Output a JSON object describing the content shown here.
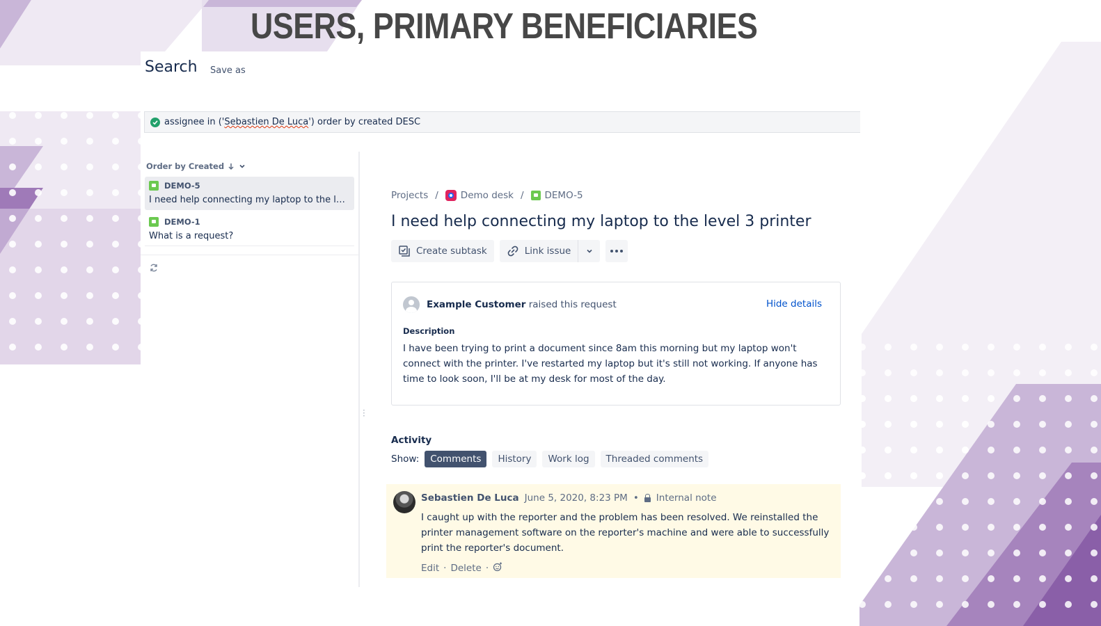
{
  "slide": {
    "title": "USERS, PRIMARY BENEFICIARIES",
    "accent_colors": [
      "#c8b3d7",
      "#a684bd",
      "#8a5fa8",
      "#ece6f1"
    ]
  },
  "search": {
    "title": "Search",
    "save_as_label": "Save as",
    "query_prefix": "assignee in ('",
    "query_name": "Sebastien De Luca",
    "query_suffix": "') order by created DESC",
    "status_icon": "check-circle-icon"
  },
  "issue_list": {
    "order_label": "Order by Created",
    "items": [
      {
        "key": "DEMO-5",
        "summary": "I need help connecting my laptop to the level 3 printer",
        "selected": true
      },
      {
        "key": "DEMO-1",
        "summary": "What is a request?",
        "selected": false
      }
    ]
  },
  "breadcrumbs": {
    "projects": "Projects",
    "separator": "/",
    "project": "Demo desk",
    "issue_key": "DEMO-5"
  },
  "issue": {
    "title": "I need help connecting my laptop to the level 3 printer",
    "toolbar": {
      "create_subtask": "Create subtask",
      "link_issue": "Link issue"
    },
    "request": {
      "reporter": "Example Customer",
      "raised_text": "raised this request",
      "hide_details": "Hide details",
      "description_label": "Description",
      "description": "I have been trying to print a document since 8am this morning but my laptop won't connect with the printer. I've restarted my laptop but it's still not working. If anyone has time to look soon, I'll be at my desk for most of the day."
    }
  },
  "activity": {
    "label": "Activity",
    "show_label": "Show:",
    "tabs": [
      "Comments",
      "History",
      "Work log",
      "Threaded comments"
    ],
    "selected_tab": "Comments",
    "comment": {
      "author": "Sebastien De Luca",
      "date": "June 5, 2020, 8:23 PM",
      "bullet": "•",
      "visibility": "Internal note",
      "body": "I caught up with the reporter and the problem has been resolved. We reinstalled the printer management software on the reporter's machine and were able to successfully print the reporter's document.",
      "edit": "Edit",
      "delete": "Delete",
      "separator": "·"
    }
  }
}
